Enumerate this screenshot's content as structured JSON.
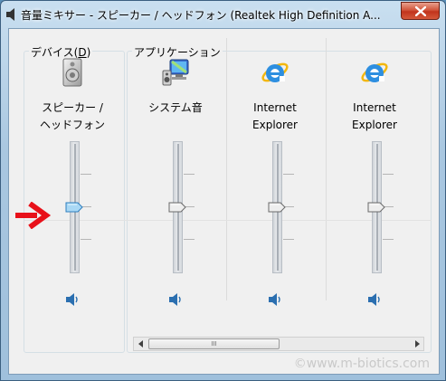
{
  "window": {
    "title": "音量ミキサー - スピーカー / ヘッドフォン (Realtek High Definition A...",
    "close_icon": "close-icon"
  },
  "device_group": {
    "label": "デバイス(D)",
    "channel": {
      "name_line1": "スピーカー /",
      "name_line2": "ヘッドフォン",
      "icon": "speaker-device-icon",
      "volume_fraction": 0.5
    }
  },
  "apps_group": {
    "label": "アプリケーション",
    "channels": [
      {
        "name_line1": "システム音",
        "name_line2": "",
        "icon": "system-sounds-icon",
        "volume_fraction": 0.5
      },
      {
        "name_line1": "Internet",
        "name_line2": "Explorer",
        "icon": "internet-explorer-icon",
        "volume_fraction": 0.5
      },
      {
        "name_line1": "Internet",
        "name_line2": "Explorer",
        "icon": "internet-explorer-icon",
        "volume_fraction": 0.5
      }
    ]
  },
  "scrollbar": {
    "grip": "III"
  },
  "watermark": "©www.m-biotics.com",
  "annotation": {
    "arrow_color": "#e8111a"
  }
}
